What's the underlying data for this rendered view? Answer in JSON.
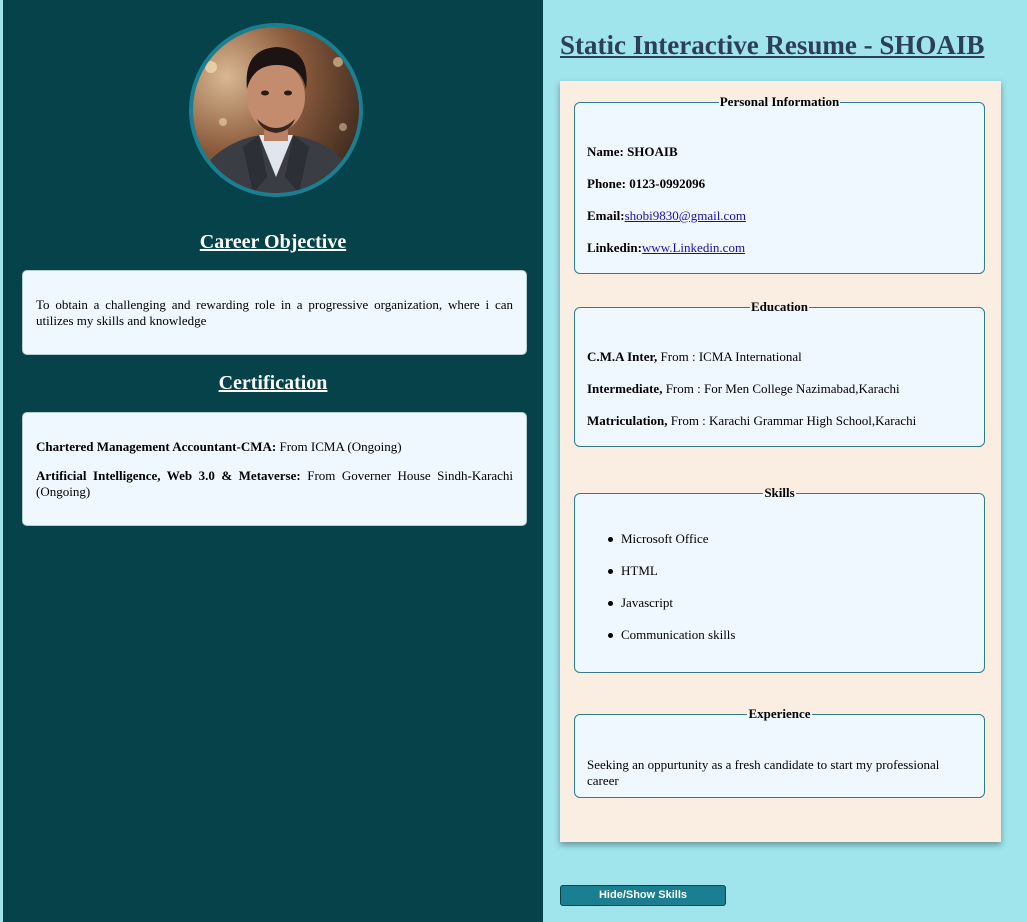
{
  "sidebar": {
    "career_title": "Career Objective",
    "career_text": "To obtain a challenging and rewarding role in a progressive organization, where i can utilizes my skills and knowledge",
    "cert_title": "Certification",
    "certs": [
      {
        "name": "Chartered Management Accountant-CMA:",
        "detail": " From ICMA (Ongoing)"
      },
      {
        "name": "Artificial Intelligence, Web 3.0 & Metaverse:",
        "detail": " From Governer House Sindh-Karachi (Ongoing)"
      }
    ]
  },
  "main": {
    "title": "Static Interactive Resume - SHOAIB",
    "personal": {
      "legend": "Personal Information",
      "name_label": "Name:",
      "name_value": "SHOAIB",
      "phone_label": "Phone:",
      "phone_value": "0123-0992096",
      "email_label": "Email:",
      "email_value": "shobi9830@gmail.com",
      "linkedin_label": "Linkedin:",
      "linkedin_value": "www.Linkedin.com"
    },
    "education": {
      "legend": "Education",
      "items": [
        {
          "degree": "C.M.A Inter,",
          "detail": " From : ICMA International"
        },
        {
          "degree": "Intermediate,",
          "detail": " From : For Men College Nazimabad,Karachi"
        },
        {
          "degree": "Matriculation,",
          "detail": " From : Karachi Grammar High School,Karachi"
        }
      ]
    },
    "skills": {
      "legend": "Skills",
      "items": [
        "Microsoft Office",
        "HTML",
        "Javascript",
        "Communication skills"
      ]
    },
    "experience": {
      "legend": "Experience",
      "text": "Seeking an oppurtunity as a fresh candidate to start my professional career"
    }
  },
  "toggle_button_label": "Hide/Show Skills",
  "colors": {
    "sidebar_bg": "#05424a",
    "page_bg": "#a0e4ec",
    "paper_bg": "#faeee2",
    "card_bg": "#f0f8ff",
    "accent": "#1a7f91",
    "title": "#2c3e5a"
  }
}
